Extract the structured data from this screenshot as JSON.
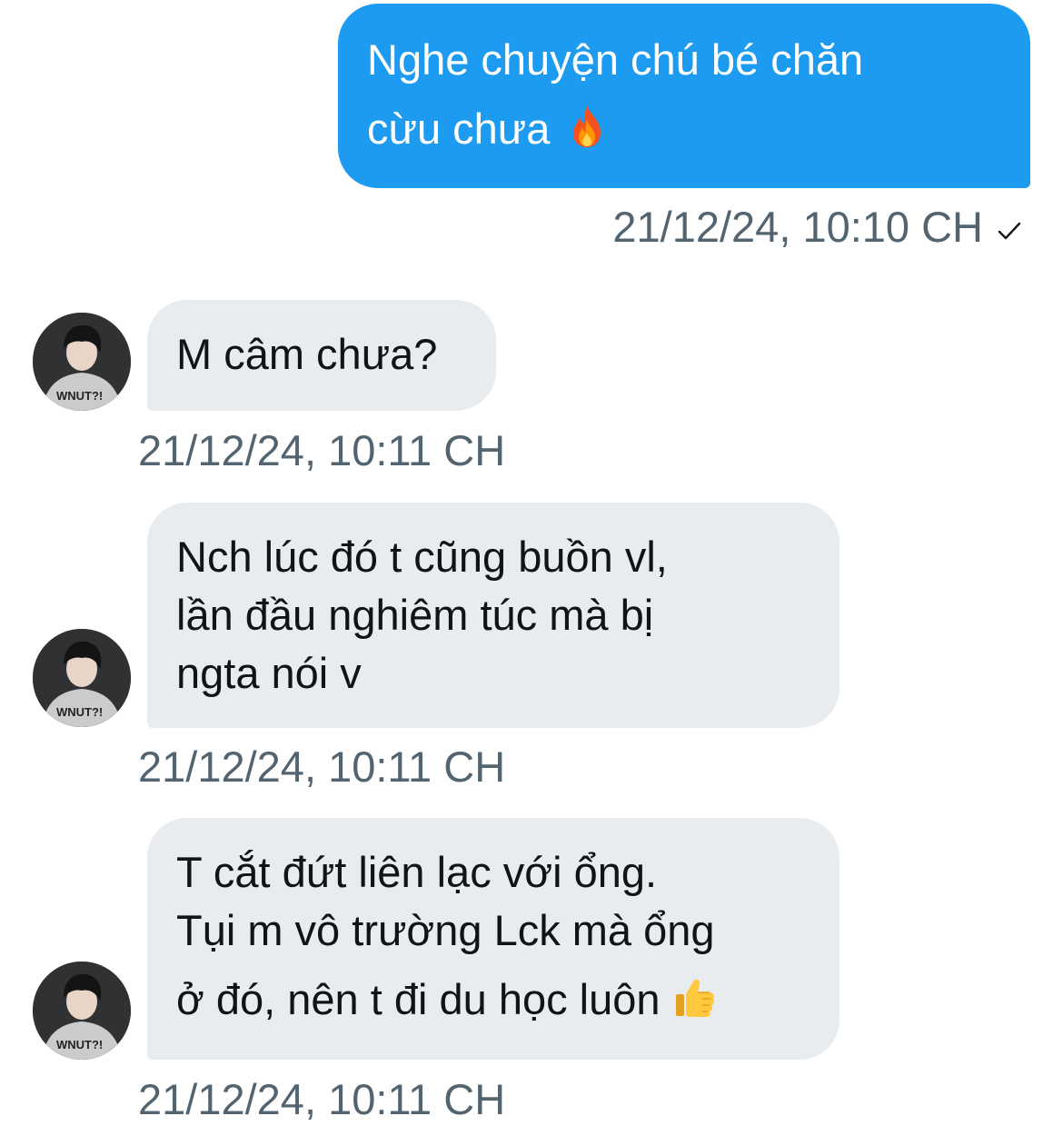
{
  "conversation": {
    "messages": [
      {
        "direction": "outgoing",
        "lines": [
          "Nghe chuyện chú bé chăn",
          "cừu chưa"
        ],
        "emoji": "fire-emoji",
        "timestamp": "21/12/24, 10:10 CH",
        "status_icon": "check-icon"
      },
      {
        "direction": "incoming",
        "lines": [
          "M câm chưa?"
        ],
        "timestamp": "21/12/24, 10:11 CH"
      },
      {
        "direction": "incoming",
        "lines": [
          "Nch lúc đó t cũng buồn vl,",
          "lần đầu nghiêm túc mà bị",
          "ngta nói v"
        ],
        "timestamp": "21/12/24, 10:11 CH"
      },
      {
        "direction": "incoming",
        "lines": [
          "T cắt đứt liên lạc với ổng.",
          "Tụi m vô trường Lck mà ổng",
          "ở đó, nên t đi du học luôn"
        ],
        "emoji": "thumbs-up-emoji",
        "timestamp": "21/12/24, 10:11 CH"
      }
    ]
  },
  "colors": {
    "outgoing_bubble": "#1d9bf0",
    "incoming_bubble": "#e9ecef",
    "timestamp_text": "#536471"
  }
}
